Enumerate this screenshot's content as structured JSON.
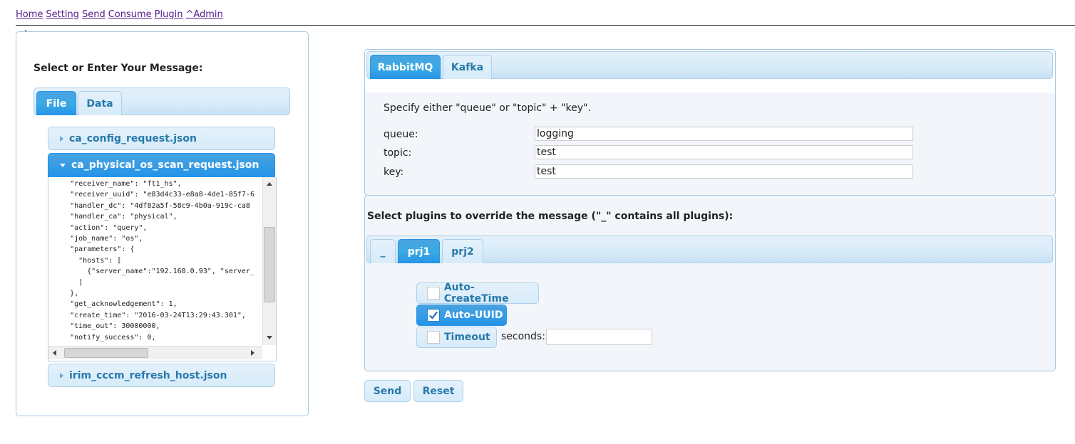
{
  "nav": {
    "links": [
      "Home",
      "Setting",
      "Send",
      "Consume",
      "Plugin",
      "^Admin"
    ]
  },
  "colors": {
    "accent": "#2694e8",
    "tab_text": "#2779aa",
    "link": "#551a8b"
  },
  "left": {
    "title": "Select or Enter Your Message:",
    "tabs": [
      {
        "label": "File",
        "active": true
      },
      {
        "label": "Data",
        "active": false
      }
    ],
    "files": [
      {
        "name": "ca_config_request.json",
        "expanded": false
      },
      {
        "name": "ca_physical_os_scan_request.json",
        "expanded": true
      },
      {
        "name": "irim_cccm_refresh_host.json",
        "expanded": false
      }
    ],
    "code": "    \"receiver_name\": \"ft1_hs\",\n    \"receiver_uuid\": \"e83d4c33-e8a8-4de1-85f7-6\n    \"handler_dc\": \"4df82a5f-58c9-4b0a-919c-ca8\n    \"handler_ca\": \"physical\",\n    \"action\": \"query\",\n    \"job_name\": \"os\",\n    \"parameters\": {\n      \"hosts\": [\n        {\"server_name\":\"192.168.0.93\", \"server_\n      ]\n    },\n    \"get_acknowledgement\": 1,\n    \"create_time\": \"2016-03-24T13:29:43.301\",\n    \"time_out\": 30000000,\n    \"notify_success\": 0,"
  },
  "transport": {
    "tabs": [
      {
        "label": "RabbitMQ",
        "active": true
      },
      {
        "label": "Kafka",
        "active": false
      }
    ],
    "instruction": "Specify either \"queue\" or \"topic\" + \"key\".",
    "fields": [
      {
        "label": "queue:",
        "value": "logging"
      },
      {
        "label": "topic:",
        "value": "test"
      },
      {
        "label": "key:",
        "value": "test"
      }
    ]
  },
  "plugins": {
    "title": "Select plugins to override the message (\"_\" contains all plugins):",
    "tabs": [
      {
        "label": "_",
        "active": false
      },
      {
        "label": "prj1",
        "active": true
      },
      {
        "label": "prj2",
        "active": false
      }
    ],
    "options": [
      {
        "label": "Auto-CreateTime",
        "checked": false
      },
      {
        "label": "Auto-UUID",
        "checked": true
      },
      {
        "label": "Timeout",
        "checked": false
      }
    ],
    "seconds_label": "seconds:",
    "seconds_value": ""
  },
  "actions": {
    "send_label": "Send",
    "reset_label": "Reset"
  }
}
